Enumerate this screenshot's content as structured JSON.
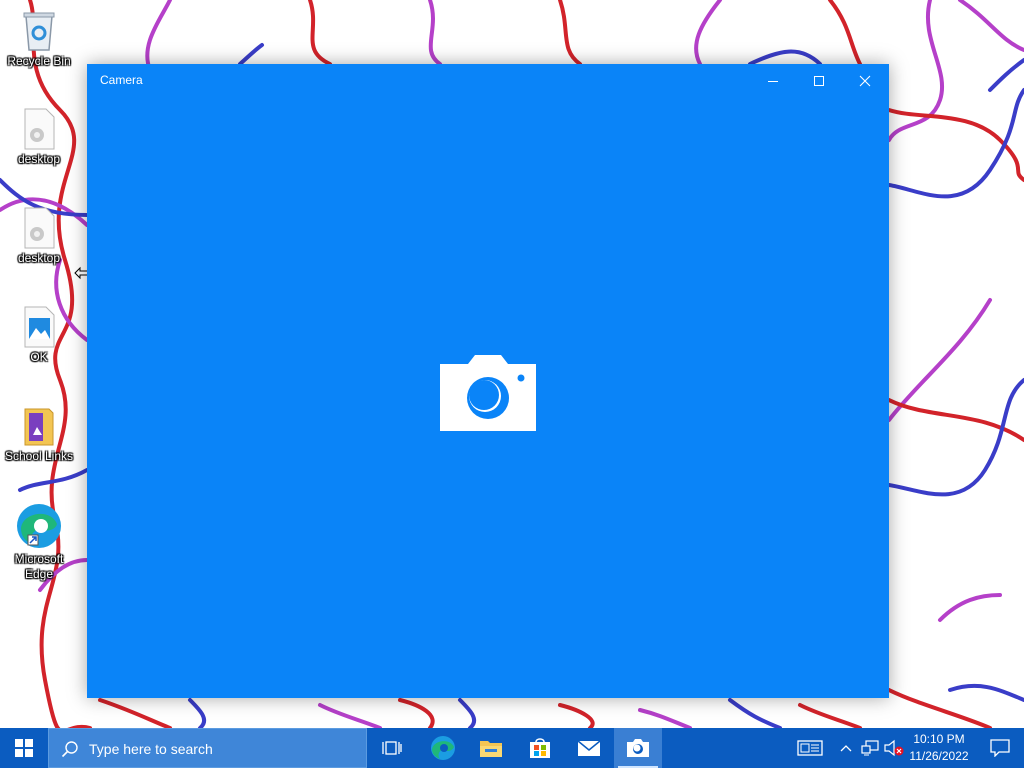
{
  "desktop": {
    "icons": [
      {
        "label": "Recycle Bin"
      },
      {
        "label": "desktop"
      },
      {
        "label": "desktop"
      },
      {
        "label": "OK"
      },
      {
        "label": "School Links"
      },
      {
        "label": "Microsoft Edge"
      }
    ]
  },
  "window": {
    "title": "Camera",
    "controls": [
      "minimize",
      "maximize",
      "close"
    ],
    "background_color": "#0a84f8",
    "center_icon": "camera-icon"
  },
  "taskbar": {
    "color": "#0b5cc0",
    "search_placeholder": "Type here to search",
    "pinned_apps": [
      "task-view-icon",
      "edge-icon",
      "file-explorer-icon",
      "store-icon",
      "mail-icon",
      "camera-icon"
    ],
    "active_app": "camera",
    "tray_icons": [
      "news-icon",
      "chevron-up-icon",
      "network-icon",
      "volume-muted-icon",
      "notification-icon"
    ],
    "time": "10:10 PM",
    "date": "11/26/2022"
  }
}
